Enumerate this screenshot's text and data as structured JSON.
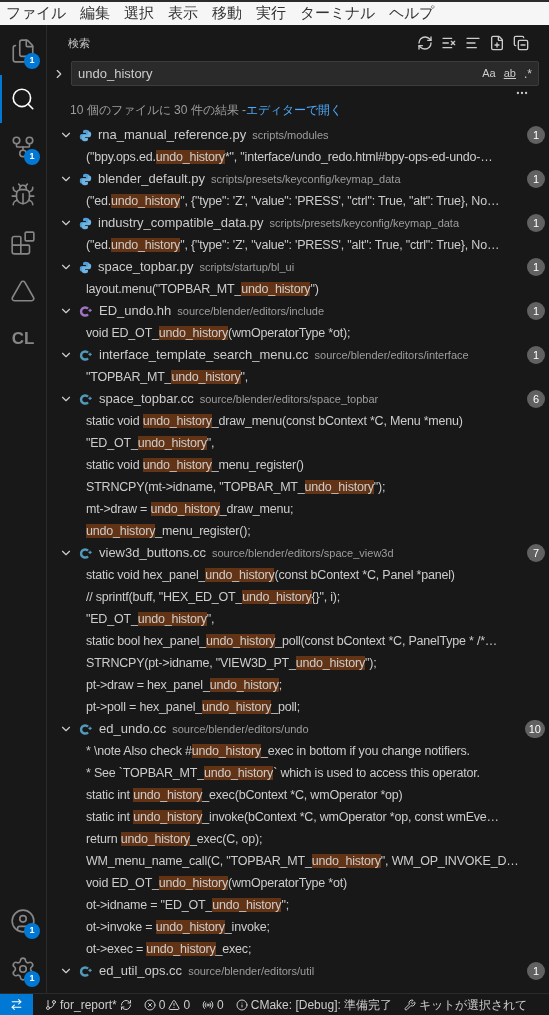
{
  "menu": [
    "ファイル",
    "編集",
    "選択",
    "表示",
    "移動",
    "実行",
    "ターミナル",
    "ヘルプ"
  ],
  "activity": [
    {
      "badge": "1",
      "selected": false
    },
    {
      "selected": true
    },
    {
      "badge": "1",
      "selected": false
    },
    {
      "selected": false
    },
    {
      "selected": false
    },
    {
      "selected": false
    },
    {
      "label": "CL",
      "selected": false
    }
  ],
  "activity_bottom": [
    {
      "badge": "1"
    },
    {
      "badge": "1"
    }
  ],
  "search": {
    "title": "検索",
    "value": "undo_history",
    "replace_expanded": false,
    "options": [
      "Aa",
      "ab",
      ".*"
    ],
    "summary": "10 個のファイルに 30 件の結果 - ",
    "link": "エディターで開く"
  },
  "results": [
    {
      "file": "rna_manual_reference.py",
      "path": "scripts/modules",
      "kind": "python",
      "count": "1",
      "expanded": true,
      "matches": [
        {
          "before": "(\"bpy.ops.ed.",
          "hit": "undo_history",
          "after": "*\", \"interface/undo_redo.html#bpy-ops-ed-undo-…"
        }
      ]
    },
    {
      "file": "blender_default.py",
      "path": "scripts/presets/keyconfig/keymap_data",
      "kind": "python",
      "count": "1",
      "expanded": true,
      "matches": [
        {
          "before": "(\"ed.",
          "hit": "undo_history",
          "after": "\", {\"type\": 'Z', \"value\": 'PRESS', \"ctrl\": True, \"alt\": True}, No…"
        }
      ]
    },
    {
      "file": "industry_compatible_data.py",
      "path": "scripts/presets/keyconfig/keymap_data",
      "kind": "python",
      "count": "1",
      "expanded": true,
      "matches": [
        {
          "before": "(\"ed.",
          "hit": "undo_history",
          "after": "\", {\"type\": 'Z', \"value\": 'PRESS', \"alt\": True, \"ctrl\": True}, No…"
        }
      ]
    },
    {
      "file": "space_topbar.py",
      "path": "scripts/startup/bl_ui",
      "kind": "python",
      "count": "1",
      "expanded": true,
      "matches": [
        {
          "before": "layout.menu(\"TOPBAR_MT_",
          "hit": "undo_history",
          "after": "\")"
        }
      ]
    },
    {
      "file": "ED_undo.hh",
      "path": "source/blender/editors/include",
      "kind": "header",
      "count": "1",
      "expanded": true,
      "matches": [
        {
          "before": "void ED_OT_",
          "hit": "undo_history",
          "after": "(wmOperatorType *ot);"
        }
      ]
    },
    {
      "file": "interface_template_search_menu.cc",
      "path": "source/blender/editors/interface",
      "kind": "cpp",
      "count": "1",
      "expanded": true,
      "matches": [
        {
          "before": "\"TOPBAR_MT_",
          "hit": "undo_history",
          "after": "\","
        }
      ]
    },
    {
      "file": "space_topbar.cc",
      "path": "source/blender/editors/space_topbar",
      "kind": "cpp",
      "count": "6",
      "expanded": true,
      "matches": [
        {
          "before": "static void ",
          "hit": "undo_history",
          "after": "_draw_menu(const bContext *C, Menu *menu)"
        },
        {
          "before": "\"ED_OT_",
          "hit": "undo_history",
          "after": "\","
        },
        {
          "before": "static void ",
          "hit": "undo_history",
          "after": "_menu_register()"
        },
        {
          "before": "STRNCPY(mt->idname, \"TOPBAR_MT_",
          "hit": "undo_history",
          "after": "\");"
        },
        {
          "before": "mt->draw = ",
          "hit": "undo_history",
          "after": "_draw_menu;"
        },
        {
          "hit": "undo_history",
          "after": "_menu_register();"
        }
      ]
    },
    {
      "file": "view3d_buttons.cc",
      "path": "source/blender/editors/space_view3d",
      "kind": "cpp",
      "count": "7",
      "expanded": true,
      "matches": [
        {
          "before": "static void hex_panel_",
          "hit": "undo_history",
          "after": "(const bContext *C, Panel *panel)"
        },
        {
          "before": "// sprintf(buff, \"HEX_ED_OT_",
          "hit": "undo_history",
          "after": "{}\", i);"
        },
        {
          "before": "\"ED_OT_",
          "hit": "undo_history",
          "after": "\","
        },
        {
          "before": "static bool hex_panel_",
          "hit": "undo_history",
          "after": "_poll(const bContext *C, PanelType * /*…"
        },
        {
          "before": "STRNCPY(pt->idname, \"VIEW3D_PT_",
          "hit": "undo_history",
          "after": "\");"
        },
        {
          "before": "pt->draw = hex_panel_",
          "hit": "undo_history",
          "after": ";"
        },
        {
          "before": "pt->poll = hex_panel_",
          "hit": "undo_history",
          "after": "_poll;"
        }
      ]
    },
    {
      "file": "ed_undo.cc",
      "path": "source/blender/editors/undo",
      "kind": "cpp",
      "count": "10",
      "expanded": true,
      "matches": [
        {
          "before": "* \\note Also check #",
          "hit": "undo_history",
          "after": "_exec in bottom if you change notifiers."
        },
        {
          "before": "* See `TOPBAR_MT_",
          "hit": "undo_history",
          "after": "` which is used to access this operator."
        },
        {
          "before": "static int ",
          "hit": "undo_history",
          "after": "_exec(bContext *C, wmOperator *op)"
        },
        {
          "before": "static int ",
          "hit": "undo_history",
          "after": "_invoke(bContext *C, wmOperator *op, const wmEve…"
        },
        {
          "before": "return ",
          "hit": "undo_history",
          "after": "_exec(C, op);"
        },
        {
          "before": "WM_menu_name_call(C, \"TOPBAR_MT_",
          "hit": "undo_history",
          "after": "\", WM_OP_INVOKE_D…"
        },
        {
          "before": "void ED_OT_",
          "hit": "undo_history",
          "after": "(wmOperatorType *ot)"
        },
        {
          "before": "ot->idname = \"ED_OT_",
          "hit": "undo_history",
          "after": "\";"
        },
        {
          "before": "ot->invoke = ",
          "hit": "undo_history",
          "after": "_invoke;"
        },
        {
          "before": "ot->exec = ",
          "hit": "undo_history",
          "after": "_exec;"
        }
      ]
    },
    {
      "file": "ed_util_ops.cc",
      "path": "source/blender/editors/util",
      "kind": "cpp",
      "count": "1",
      "expanded": true
    }
  ],
  "status_bar": {
    "branch": "for_report*",
    "errors": "0",
    "warnings": "0",
    "ports": "0",
    "cmake": "CMake: [Debug]: 準備完了",
    "kit": "キットが選択されて"
  }
}
